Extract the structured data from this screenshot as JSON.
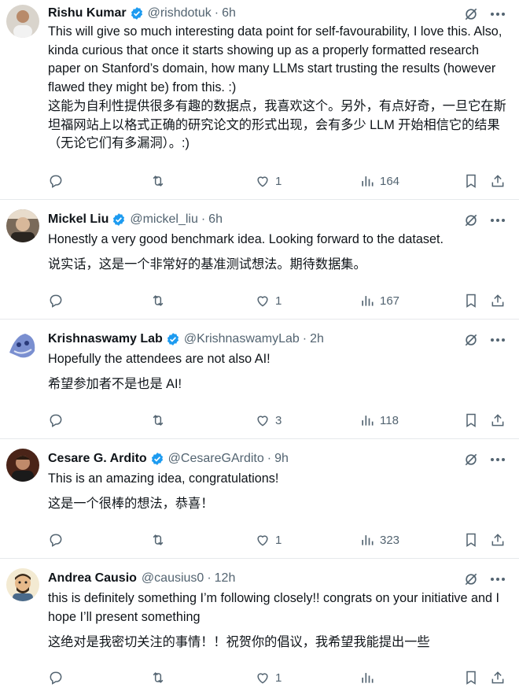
{
  "tweets": [
    {
      "name": "Rishu Kumar",
      "handle": "@rishdotuk",
      "time": "6h",
      "text_en": "This will give so much interesting data point for self-favourability, I love this. Also, kinda curious that once it starts showing up as a properly formatted research paper on Stanford’s domain, how many LLMs start trusting the results (however flawed they might be) from this. :)",
      "text_zh": "这能为自利性提供很多有趣的数据点，我喜欢这个。另外，有点好奇，一旦它在斯坦福网站上以格式正确的研究论文的形式出现，会有多少 LLM 开始相信它的结果（无论它们有多漏洞）。:)",
      "likes": "1",
      "views": "164",
      "avatar_color": "#c9b8a6"
    },
    {
      "name": "Mickel Liu",
      "handle": "@mickel_liu",
      "time": "6h",
      "text_en": "Honestly a very good benchmark idea. Looking forward to the dataset.",
      "text_zh": "说实话，这是一个非常好的基准测试想法。期待数据集。",
      "likes": "1",
      "views": "167",
      "avatar_color": "#8a7a6a"
    },
    {
      "name": "Krishnaswamy Lab",
      "handle": "@KrishnaswamyLab",
      "time": "2h",
      "text_en": "Hopefully the attendees are not also AI!",
      "text_zh": "希望参加者不是也是 AI!",
      "likes": "3",
      "views": "118",
      "avatar_color": "#5a6fa8"
    },
    {
      "name": "Cesare G. Ardito",
      "handle": "@CesareGArdito",
      "time": "9h",
      "text_en": "This is an amazing idea, congratulations!",
      "text_zh": "这是一个很棒的想法，恭喜！",
      "likes": "1",
      "views": "323",
      "avatar_color": "#6b3a2a"
    },
    {
      "name": "Andrea Causio",
      "handle": "@causius0",
      "time": "12h",
      "text_en": "this is definitely something I’m following closely!! congrats on your initiative and I hope I’ll present something",
      "text_zh": "这绝对是我密切关注的事情！！祝贺你的倡议，我希望我能提出一些",
      "likes": "1",
      "views": "",
      "avatar_color": "#e8d9b8"
    }
  ],
  "colors": {
    "verified": "#1d9bf0",
    "muted": "#536471",
    "text": "#0f1419"
  },
  "icons": [
    "reply-icon",
    "retweet-icon",
    "like-icon",
    "views-icon",
    "bookmark-icon",
    "share-icon",
    "grok-icon",
    "more-icon",
    "verified-badge-icon"
  ]
}
